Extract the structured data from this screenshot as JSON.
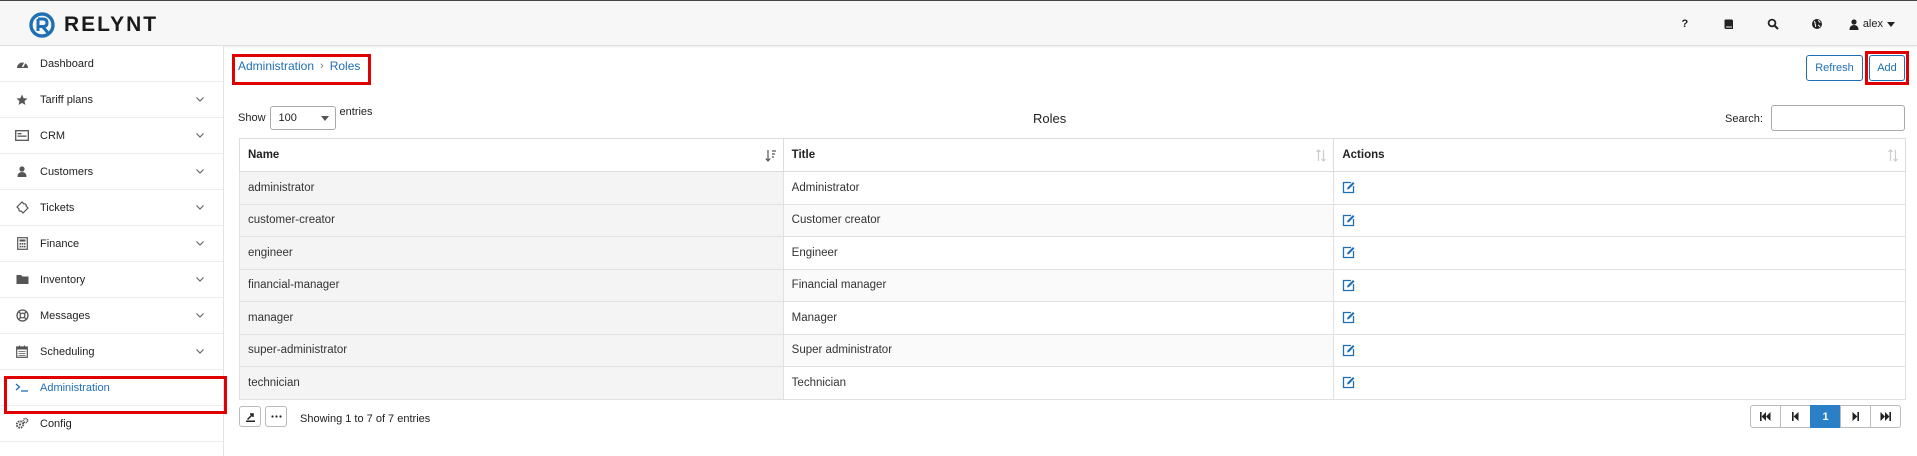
{
  "app": {
    "logo_text": "RELYNT",
    "brand_color": "#1f6fb5"
  },
  "topbar": {
    "help_label": "?",
    "icons": [
      "book-icon",
      "search-icon",
      "globe-icon"
    ],
    "user_name": "alex"
  },
  "sidebar": {
    "items": [
      {
        "label": "Dashboard",
        "icon": "dashboard-icon",
        "expandable": false
      },
      {
        "label": "Tariff plans",
        "icon": "star-icon",
        "expandable": true
      },
      {
        "label": "CRM",
        "icon": "id-card-icon",
        "expandable": true
      },
      {
        "label": "Customers",
        "icon": "user-icon",
        "expandable": true
      },
      {
        "label": "Tickets",
        "icon": "ticket-icon",
        "expandable": true
      },
      {
        "label": "Finance",
        "icon": "calculator-icon",
        "expandable": true
      },
      {
        "label": "Inventory",
        "icon": "folder-icon",
        "expandable": true
      },
      {
        "label": "Messages",
        "icon": "lifebuoy-icon",
        "expandable": true
      },
      {
        "label": "Scheduling",
        "icon": "calendar-icon",
        "expandable": true
      },
      {
        "label": "Administration",
        "icon": "terminal-icon",
        "expandable": false,
        "active": true
      },
      {
        "label": "Config",
        "icon": "cogs-icon",
        "expandable": false
      }
    ]
  },
  "breadcrumb": {
    "parent": "Administration",
    "current": "Roles"
  },
  "actions": {
    "refresh_label": "Refresh",
    "add_label": "Add"
  },
  "table_controls": {
    "show_label": "Show",
    "page_size": "100",
    "entries_label": "entries",
    "table_title": "Roles",
    "search_label": "Search:",
    "search_value": ""
  },
  "table": {
    "columns": [
      "Name",
      "Title",
      "Actions"
    ],
    "rows": [
      {
        "name": "administrator",
        "title": "Administrator"
      },
      {
        "name": "customer-creator",
        "title": "Customer creator"
      },
      {
        "name": "engineer",
        "title": "Engineer"
      },
      {
        "name": "financial-manager",
        "title": "Financial manager"
      },
      {
        "name": "manager",
        "title": "Manager"
      },
      {
        "name": "super-administrator",
        "title": "Super administrator"
      },
      {
        "name": "technician",
        "title": "Technician"
      }
    ]
  },
  "footer": {
    "showing_text": "Showing 1 to 7 of 7 entries",
    "current_page": "1"
  }
}
